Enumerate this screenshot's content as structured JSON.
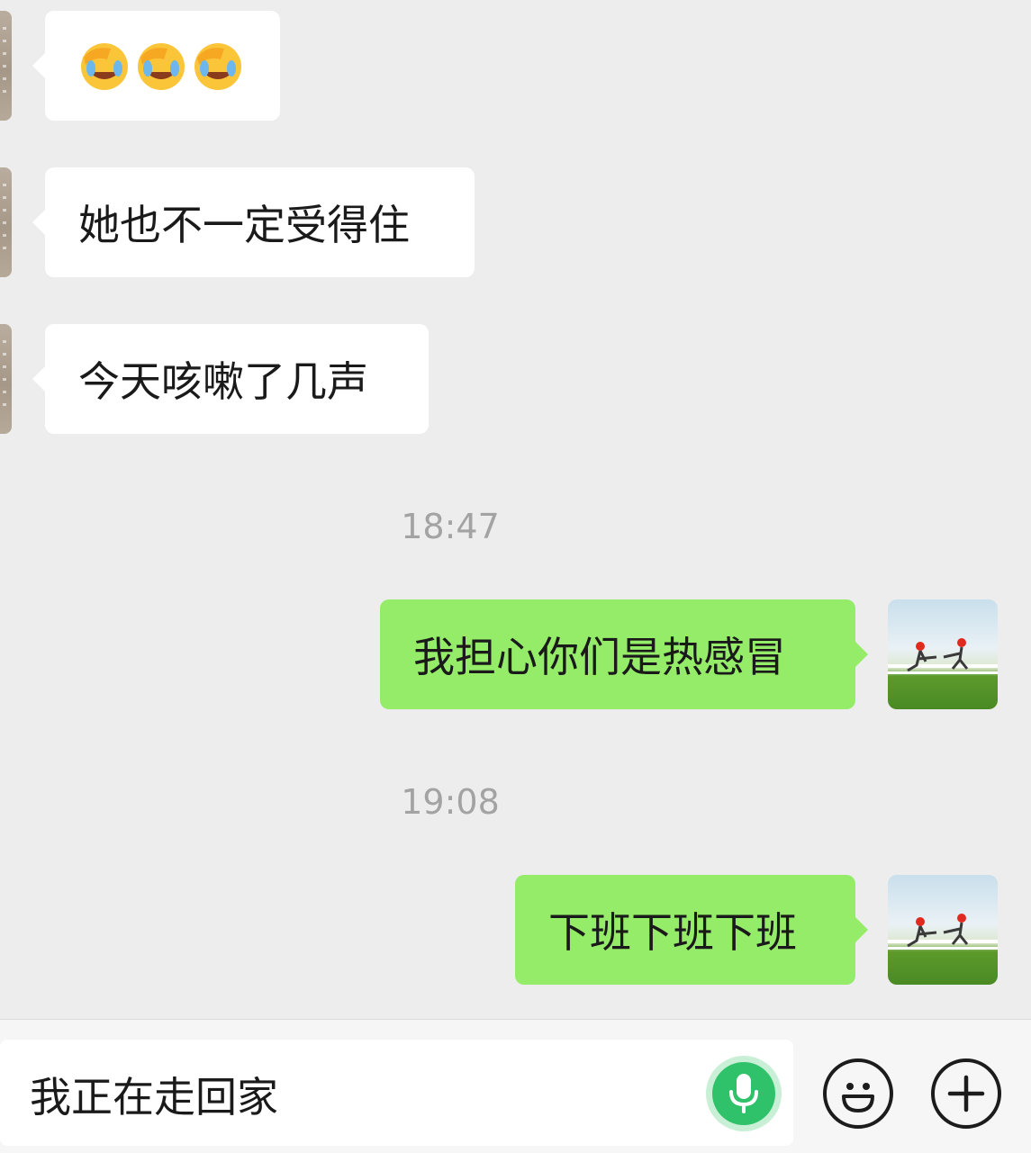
{
  "messages": [
    {
      "side": "in",
      "type": "emoji",
      "emojis": [
        "face-palm-laughing-emoji",
        "face-palm-laughing-emoji",
        "face-palm-laughing-emoji"
      ]
    },
    {
      "side": "in",
      "text": "她也不一定受得住"
    },
    {
      "side": "in",
      "text": "今天咳嗽了几声"
    },
    {
      "type": "time",
      "text": "18:47"
    },
    {
      "side": "out",
      "text": "我担心你们是热感冒"
    },
    {
      "type": "time",
      "text": "19:08"
    },
    {
      "side": "out",
      "text": "下班下班下班"
    }
  ],
  "input": {
    "value": "我正在走回家"
  },
  "icons": {
    "voice": "microphone-icon",
    "emoji": "smiley-face-icon",
    "more": "plus-circle-icon"
  },
  "colors": {
    "background": "#ededed",
    "incoming_bubble": "#ffffff",
    "outgoing_bubble": "#95ec69",
    "mic_button": "#2fc26a"
  }
}
